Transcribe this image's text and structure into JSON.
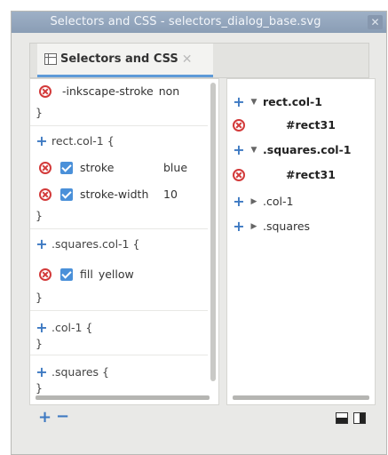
{
  "window": {
    "title": "Selectors and CSS - selectors_dialog_base.svg",
    "close_glyph": "✕"
  },
  "tab": {
    "label": "Selectors and CSS",
    "close_glyph": "✕",
    "icon": "dialog-icon"
  },
  "left_panel": {
    "partial_row": {
      "property": "-inkscape-stroke",
      "value": "non"
    },
    "rules": [
      {
        "selector": "rect.col-1 {",
        "properties": [
          {
            "name": "stroke",
            "value": "blue",
            "checked": true
          },
          {
            "name": "stroke-width",
            "value": "10",
            "checked": true
          }
        ]
      },
      {
        "selector": ".squares.col-1 {",
        "properties": [
          {
            "name": "fill",
            "value": "yellow",
            "checked": true
          }
        ]
      },
      {
        "selector": ".col-1 {",
        "properties": []
      },
      {
        "selector": ".squares {",
        "properties": []
      }
    ],
    "closing_brace": "}"
  },
  "right_panel": {
    "items": [
      {
        "label": "rect.col-1",
        "bold": true,
        "expanded": true,
        "icon": "plus-icon"
      },
      {
        "label": "#rect31",
        "bold": true,
        "child": true,
        "icon": "delete-icon"
      },
      {
        "label": ".squares.col-1",
        "bold": true,
        "expanded": true,
        "icon": "plus-icon"
      },
      {
        "label": "#rect31",
        "bold": true,
        "child": true,
        "icon": "delete-icon"
      },
      {
        "label": ".col-1",
        "bold": false,
        "expanded": false,
        "icon": "plus-icon"
      },
      {
        "label": ".squares",
        "bold": false,
        "expanded": false,
        "icon": "plus-icon"
      }
    ]
  },
  "bottom_bar": {
    "add_glyph": "+",
    "remove_glyph": "−"
  },
  "colors": {
    "accent": "#4a90d9",
    "delete": "#d33a3a",
    "titlebar": "#8a9db5"
  }
}
